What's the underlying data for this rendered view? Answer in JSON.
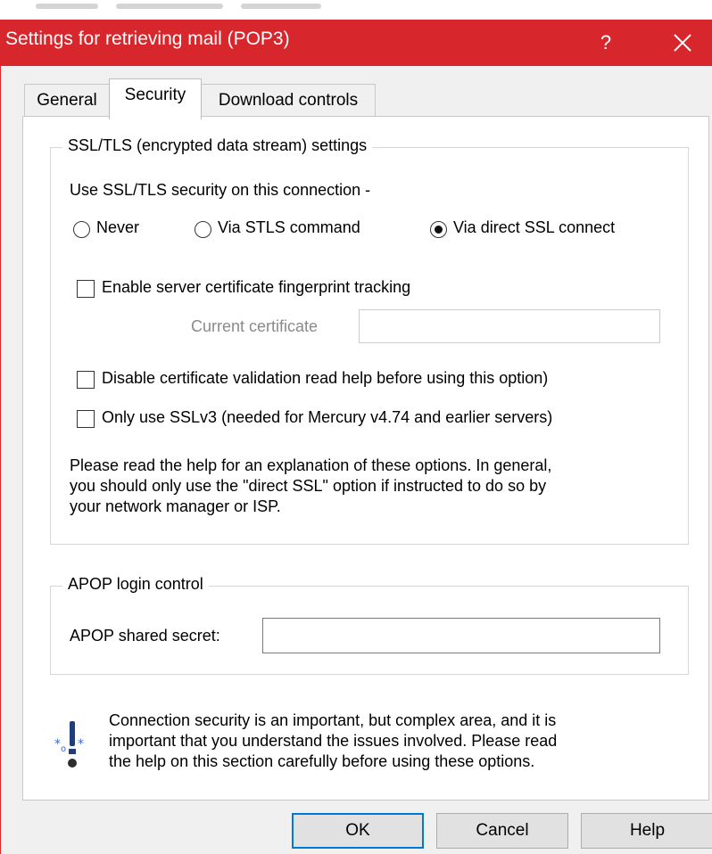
{
  "window": {
    "title": "Settings for retrieving mail (POP3)",
    "help_glyph": "?",
    "close_icon": "close-icon",
    "title_bar_color": "#d8262d"
  },
  "tabs": [
    {
      "label": "General",
      "active": false
    },
    {
      "label": "Security",
      "active": true
    },
    {
      "label": "Download controls",
      "active": false
    }
  ],
  "ssl_group": {
    "label": "SSL/TLS (encrypted data stream) settings",
    "prompt": "Use SSL/TLS security on this connection -",
    "radios": [
      {
        "label": "Never",
        "selected": false
      },
      {
        "label": "Via STLS command",
        "selected": false
      },
      {
        "label": "Via direct SSL connect",
        "selected": true
      }
    ],
    "fingerprint_checkbox": {
      "label": "Enable server certificate fingerprint tracking",
      "checked": false
    },
    "current_certificate": {
      "label": "Current certificate",
      "value": ""
    },
    "disable_validation_checkbox": {
      "label": "Disable certificate validation read help before using this option)",
      "checked": false
    },
    "sslv3_checkbox": {
      "label": "Only use SSLv3 (needed for Mercury v4.74 and earlier servers)",
      "checked": false
    },
    "help_lines": [
      "Please read the help for an explanation of these options. In general,",
      "you should only use the \"direct SSL\" option if instructed to do so by",
      "your network manager or ISP."
    ]
  },
  "apop_group": {
    "label": "APOP login control",
    "field_label": "APOP shared secret:",
    "field_value": ""
  },
  "info": {
    "icon": "warning-tip-icon",
    "lines": [
      "Connection security is an important, but complex area, and it is",
      "important that you understand the issues involved. Please read",
      "the help on this section carefully before using these options."
    ]
  },
  "buttons": {
    "ok": "OK",
    "cancel": "Cancel",
    "help": "Help"
  },
  "colors": {
    "accent": "#0078d7",
    "dialog_bg": "#f0f0f0"
  }
}
